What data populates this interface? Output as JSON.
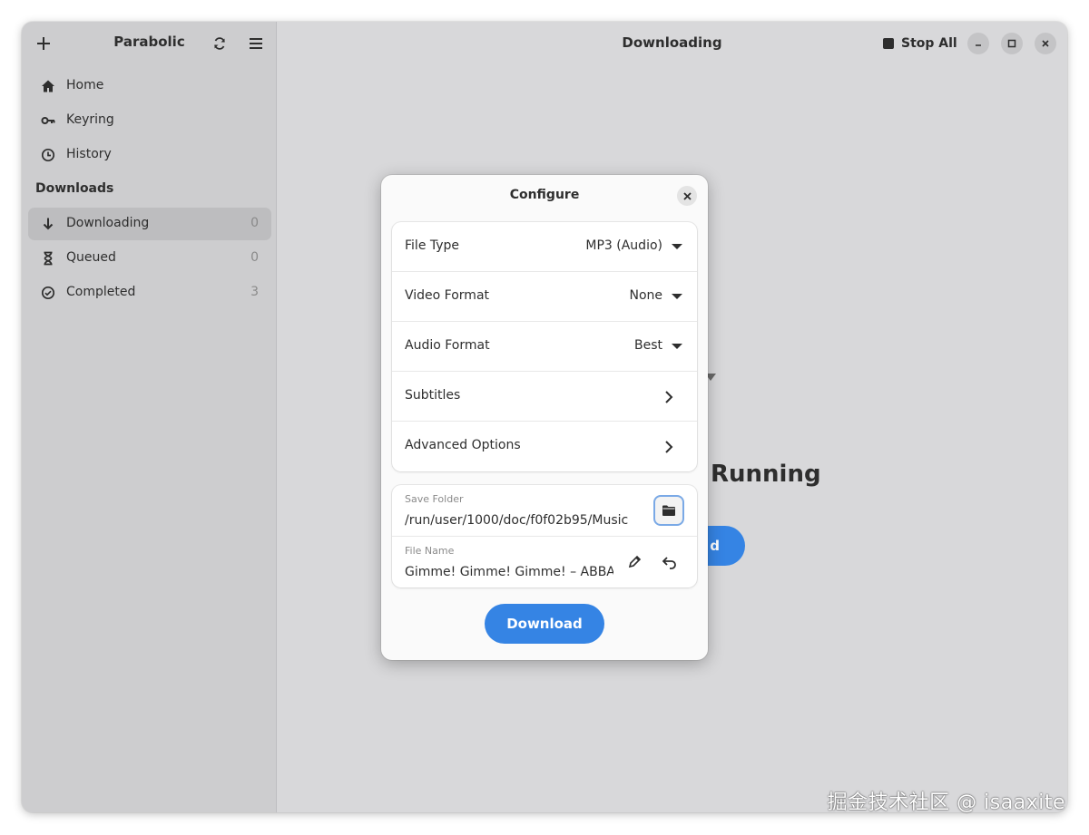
{
  "sidebar": {
    "title": "Parabolic",
    "items": [
      {
        "label": "Home",
        "icon": "home-icon"
      },
      {
        "label": "Keyring",
        "icon": "key-icon"
      },
      {
        "label": "History",
        "icon": "clock-icon"
      }
    ],
    "section_label": "Downloads",
    "download_items": [
      {
        "label": "Downloading",
        "count": "0",
        "icon": "arrow-down-icon",
        "active": true
      },
      {
        "label": "Queued",
        "count": "0",
        "icon": "hourglass-icon"
      },
      {
        "label": "Completed",
        "count": "3",
        "icon": "check-circle-icon"
      }
    ]
  },
  "main": {
    "title": "Downloading",
    "stop_all_label": "Stop All",
    "background_heading": "Running",
    "background_button": "d"
  },
  "dialog": {
    "title": "Configure",
    "rows": [
      {
        "label": "File Type",
        "value": "MP3 (Audio)"
      },
      {
        "label": "Video Format",
        "value": "None"
      },
      {
        "label": "Audio Format",
        "value": "Best"
      },
      {
        "label": "Subtitles"
      },
      {
        "label": "Advanced Options"
      }
    ],
    "save_folder": {
      "label": "Save Folder",
      "value": "/run/user/1000/doc/f0f02b95/Music"
    },
    "file_name": {
      "label": "File Name",
      "value": "Gimme! Gimme! Gimme!  – ABBA"
    },
    "download_label": "Download"
  },
  "watermark": "掘金技术社区 @ isaaxite",
  "colors": {
    "accent": "#3584e4",
    "sidebar": "#cdcdcf",
    "main_bg": "#d8d8da",
    "dialog_bg": "#fafafa"
  }
}
